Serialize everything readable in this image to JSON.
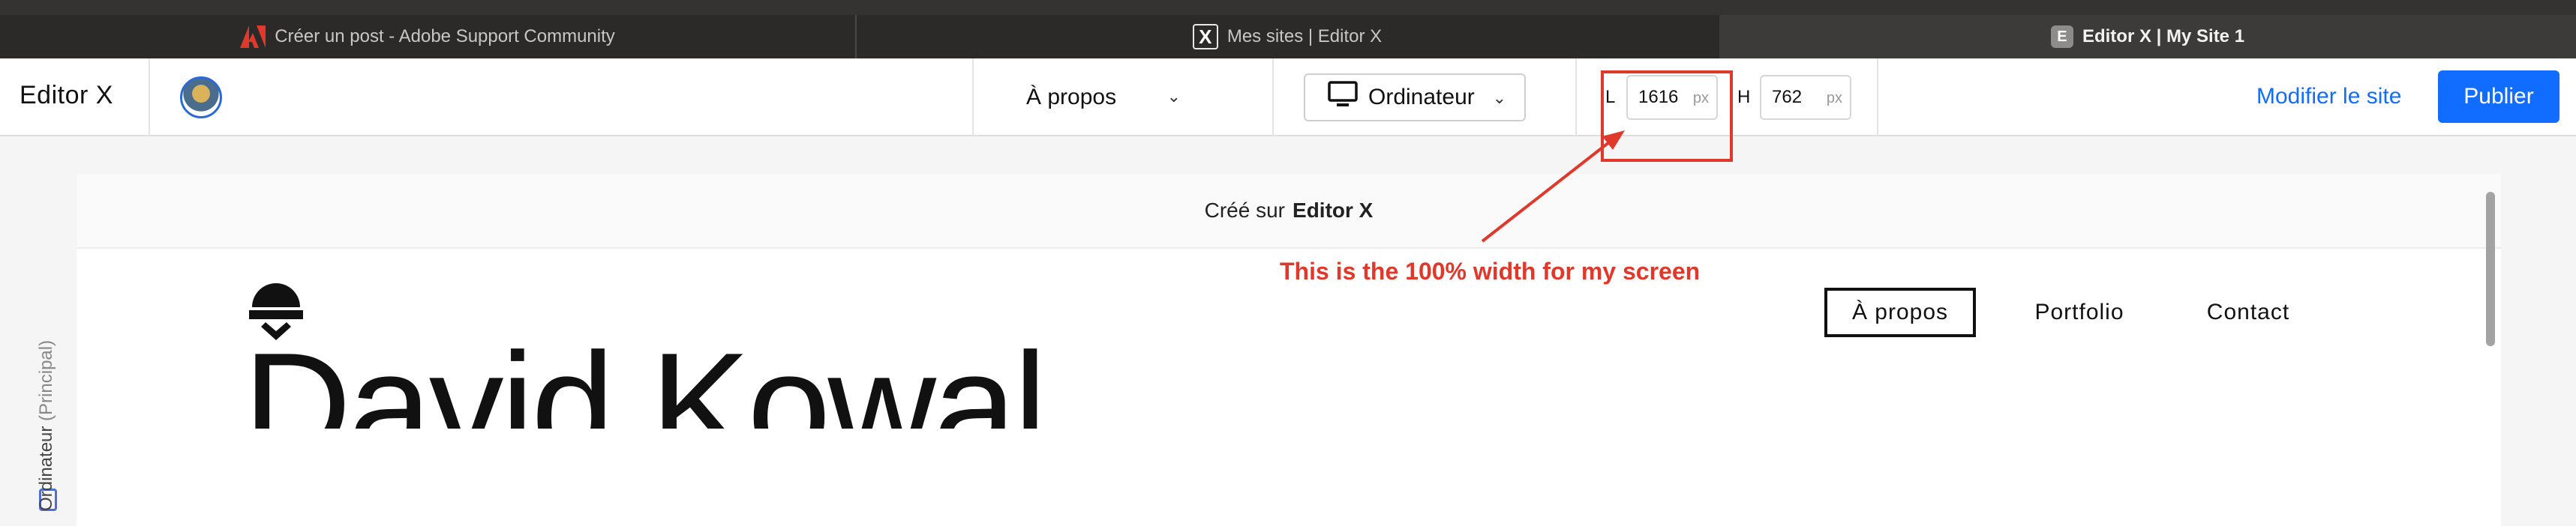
{
  "browser": {
    "tabs": [
      {
        "title": "Créer un post - Adobe Support Community",
        "icon": "adobe-icon",
        "active": false
      },
      {
        "title": "Mes sites | Editor X",
        "icon": "editor-x-icon",
        "active": false
      },
      {
        "title": "Editor X | My Site 1",
        "icon": "site-favicon",
        "icon_letter": "E",
        "active": true
      }
    ]
  },
  "toolbar": {
    "brand": "Editor X",
    "page_select": "À propos",
    "device_select": "Ordinateur",
    "width_label": "L",
    "width_value": "1616",
    "height_label": "H",
    "height_value": "762",
    "unit": "px",
    "edit_link": "Modifier le site",
    "publish_label": "Publier",
    "accent_color": "#116dff"
  },
  "left_rail": {
    "label": "Ordinateur",
    "sub_label": "(Principal)"
  },
  "canvas": {
    "banner_prefix": "Créé sur",
    "banner_brand": "Editor X",
    "hero_name": "David Kowal",
    "nav": [
      "À propos",
      "Portfolio",
      "Contact"
    ],
    "active_nav": "À propos"
  },
  "annotation": {
    "text": "This is the 100% width for my screen",
    "color": "#e0392b"
  }
}
